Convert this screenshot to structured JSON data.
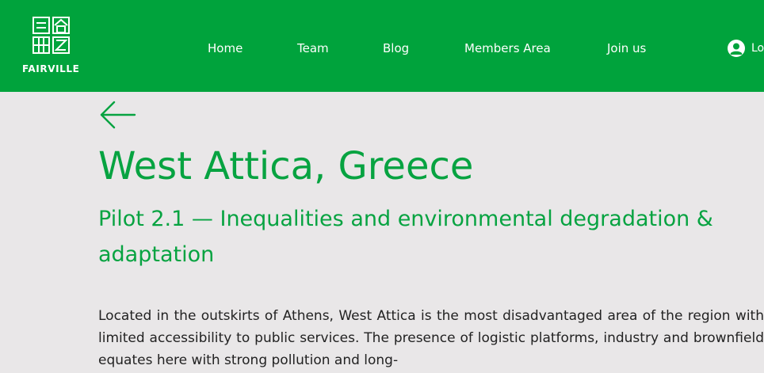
{
  "brand": {
    "name": "FAIRVILLE"
  },
  "nav": {
    "items": [
      {
        "label": "Home"
      },
      {
        "label": "Team"
      },
      {
        "label": "Blog"
      },
      {
        "label": "Members Area"
      },
      {
        "label": "Join us"
      }
    ],
    "login_label": "Lo"
  },
  "page": {
    "title": "West Attica, Greece",
    "subtitle": "Pilot 2.1 — Inequalities and environmental degradation & adaptation",
    "body": "Located in the outskirts of Athens, West Attica is the most disadvantaged area of the region with limited accessibility to public services. The presence of logistic platforms, industry and brownfield equates here with strong pollution and long-"
  },
  "colors": {
    "header_bg": "#00a33c",
    "accent_text": "#07a341",
    "page_bg": "#e9e7e8"
  },
  "icons": {
    "logo": "fairville-logo-icon",
    "back": "arrow-left-icon",
    "user": "user-avatar-icon"
  }
}
